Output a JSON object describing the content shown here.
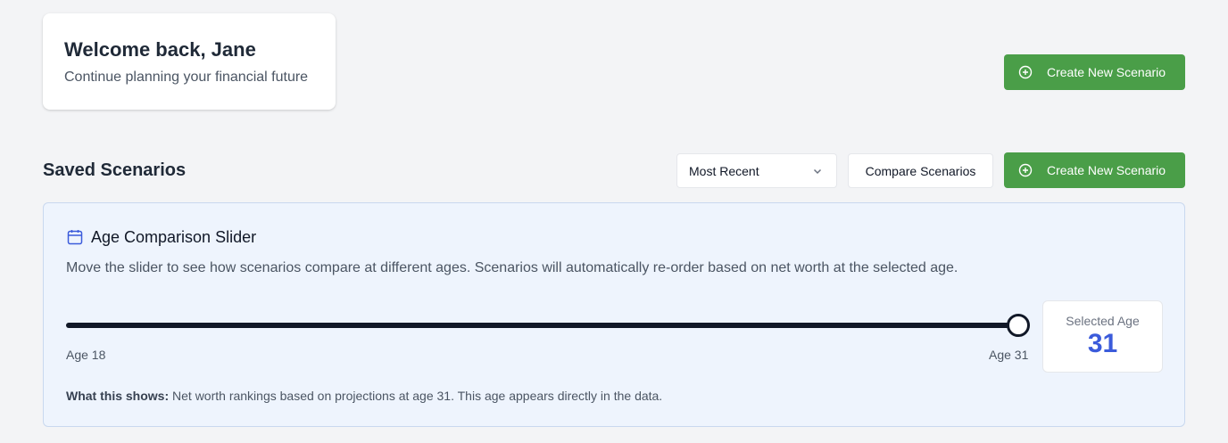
{
  "welcome": {
    "title": "Welcome back, Jane",
    "subtitle": "Continue planning your financial future"
  },
  "header_action": {
    "label": "Create New Scenario",
    "icon": "plus-circle-icon"
  },
  "saved": {
    "title": "Saved Scenarios",
    "sort_selected": "Most Recent",
    "compare_label": "Compare Scenarios",
    "create_label": "Create New Scenario"
  },
  "age_slider": {
    "title": "Age Comparison Slider",
    "icon": "calendar-icon",
    "description": "Move the slider to see how scenarios compare at different ages. Scenarios will automatically re-order based on net worth at the selected age.",
    "min_label": "Age 18",
    "max_label": "Age 31",
    "min": 18,
    "max": 31,
    "value": 31,
    "selected_label": "Selected Age",
    "selected_value": "31",
    "note_label": "What this shows:",
    "note_text": " Net worth rankings based on projections at age 31. This age appears directly in the data."
  },
  "colors": {
    "accent_green": "#4a9e48",
    "accent_blue": "#3b5bdb",
    "panel_bg": "#eef4fd"
  }
}
